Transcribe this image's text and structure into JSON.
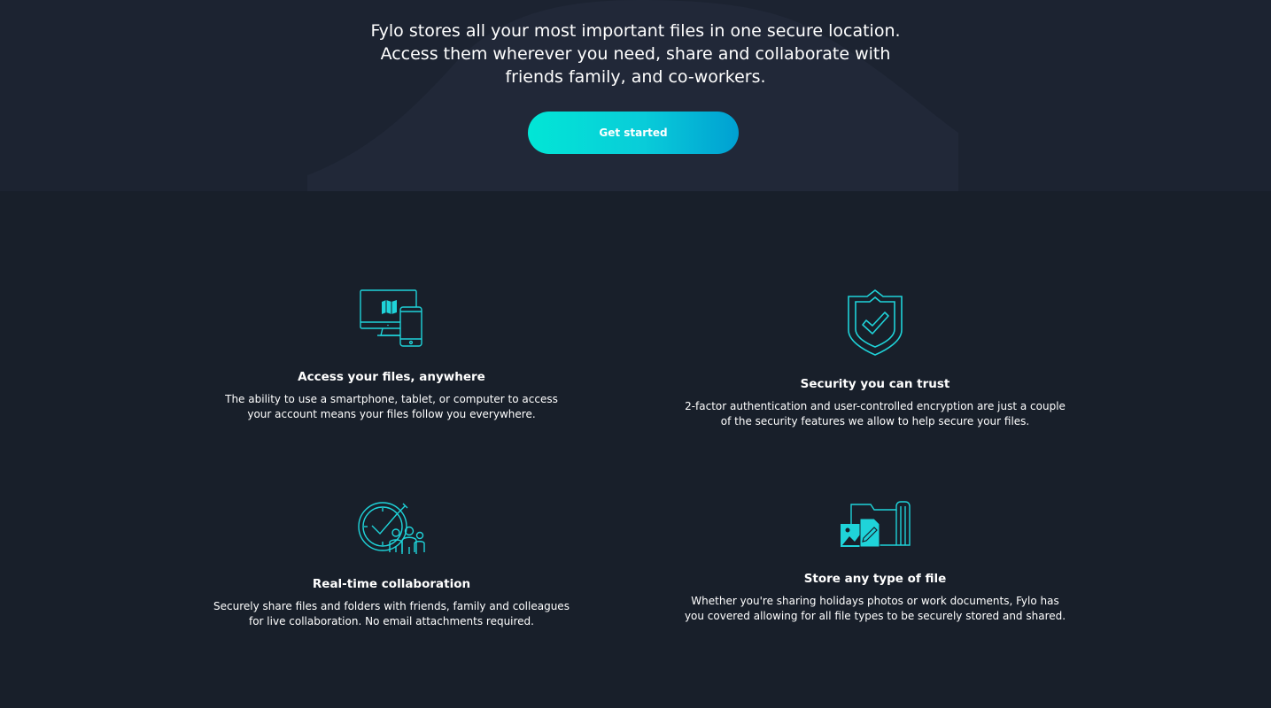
{
  "hero": {
    "lines": [
      "Fylo stores all your most important files in one secure location.",
      "Access them wherever you need, share and collaborate with",
      "friends family, and co-workers."
    ],
    "cta_label": "Get started"
  },
  "features": [
    {
      "icon": "devices-icon",
      "title": "Access your files, anywhere",
      "text": "The ability to use a smartphone, tablet, or computer to access your account means your files follow you everywhere."
    },
    {
      "icon": "shield-check-icon",
      "title": "Security you can trust",
      "text": "2-factor authentication and user-controlled encryption are just a couple of the security features we allow to help secure your files."
    },
    {
      "icon": "collaboration-icon",
      "title": "Real-time collaboration",
      "text": "Securely share files and folders with friends, family and colleagues for live collaboration. No email attachments required."
    },
    {
      "icon": "folder-files-icon",
      "title": "Store any type of file",
      "text": "Whether you're sharing holidays photos or work documents, Fylo has you covered allowing for all file types to be securely stored and shared."
    }
  ],
  "colors": {
    "background": "#181f2a",
    "hero_background": "#1c2331",
    "accent_start": "#02e6d6",
    "accent_end": "#00a0d2",
    "icon_stroke": "#1fd3d9"
  }
}
